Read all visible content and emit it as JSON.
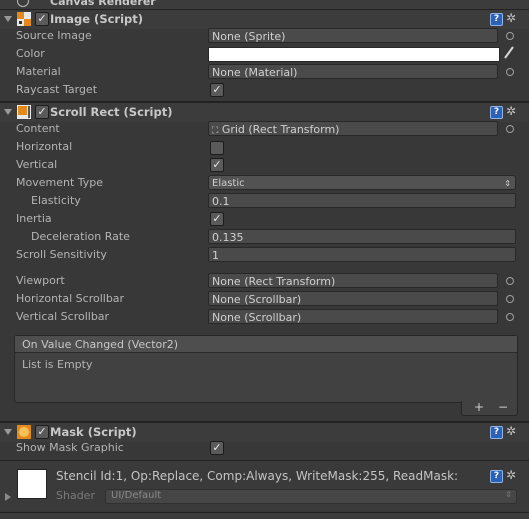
{
  "top": {
    "title": "Canvas Renderer"
  },
  "image": {
    "title": "Image (Script)",
    "rows": {
      "source_image": {
        "label": "Source Image",
        "value": "None (Sprite)"
      },
      "color": {
        "label": "Color"
      },
      "material": {
        "label": "Material",
        "value": "None (Material)"
      },
      "raycast": {
        "label": "Raycast Target"
      }
    }
  },
  "scroll": {
    "title": "Scroll Rect (Script)",
    "content": {
      "label": "Content",
      "value": "Grid (Rect Transform)"
    },
    "horizontal": {
      "label": "Horizontal"
    },
    "vertical": {
      "label": "Vertical"
    },
    "movement": {
      "label": "Movement Type",
      "value": "Elastic"
    },
    "elasticity": {
      "label": "Elasticity",
      "value": "0.1"
    },
    "inertia": {
      "label": "Inertia"
    },
    "deceleration": {
      "label": "Deceleration Rate",
      "value": "0.135"
    },
    "sensitivity": {
      "label": "Scroll Sensitivity",
      "value": "1"
    },
    "viewport": {
      "label": "Viewport",
      "value": "None (Rect Transform)"
    },
    "h_scrollbar": {
      "label": "Horizontal Scrollbar",
      "value": "None (Scrollbar)"
    },
    "v_scrollbar": {
      "label": "Vertical Scrollbar",
      "value": "None (Scrollbar)"
    },
    "event": {
      "title": "On Value Changed (Vector2)",
      "empty": "List is Empty",
      "add": "+",
      "remove": "−"
    }
  },
  "mask": {
    "title": "Mask (Script)",
    "show_graphic": {
      "label": "Show Mask Graphic"
    }
  },
  "material_preview": {
    "stencil": "Stencil Id:1, Op:Replace, Comp:Always, WriteMask:255, ReadMask:",
    "shader_label": "Shader",
    "shader_value": "UI/Default"
  },
  "colors": {
    "accent": "#2b62b5",
    "background": "#383838",
    "field": "#4a4a4a"
  }
}
